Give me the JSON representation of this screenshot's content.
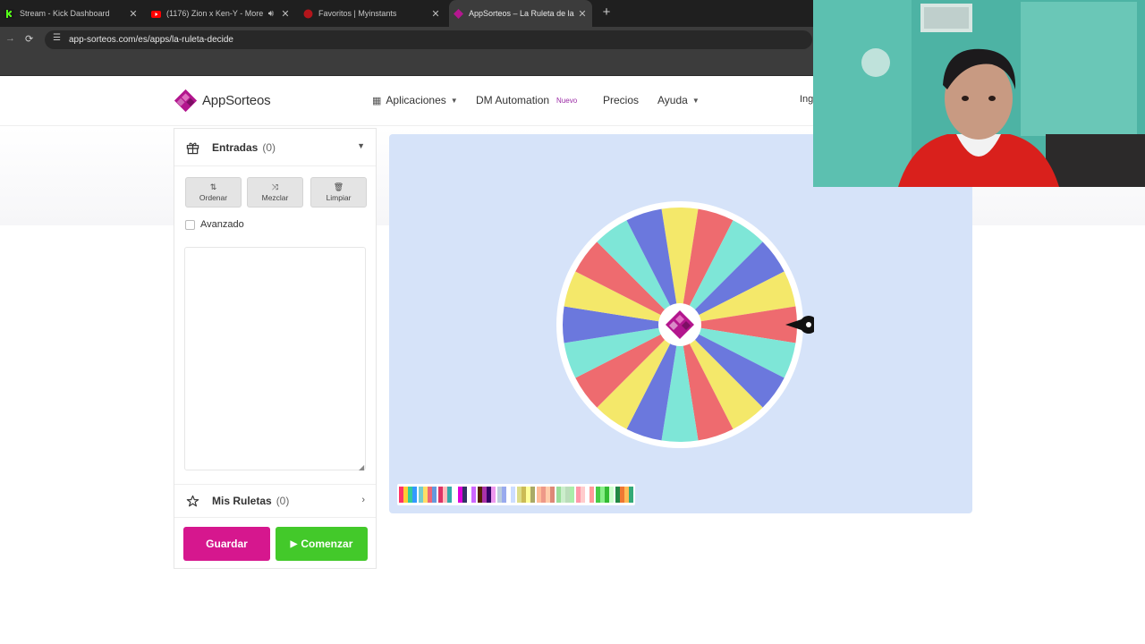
{
  "browser": {
    "tabs": [
      {
        "title": "Stream - Kick Dashboard",
        "favicon": "kick-icon",
        "active": false
      },
      {
        "title": "(1176) Zion x Ken-Y - More",
        "favicon": "youtube-icon",
        "active": false,
        "audio": true
      },
      {
        "title": "Favoritos | Myinstants",
        "favicon": "myinstants-icon",
        "active": false
      },
      {
        "title": "AppSorteos – La Ruleta de la Su",
        "favicon": "appsorteos-icon",
        "active": true
      }
    ],
    "url": "app-sorteos.com/es/apps/la-ruleta-decide"
  },
  "header": {
    "logo_text": "AppSorteos",
    "nav": {
      "aplicaciones": "Aplicaciones",
      "dm_automation": "DM Automation",
      "nuevo_badge": "Nuevo",
      "precios": "Precios",
      "ayuda": "Ayuda",
      "login_peek": "Ing"
    }
  },
  "left_panel": {
    "entradas": {
      "title": "Entradas",
      "count": "(0)"
    },
    "tools": {
      "ordenar": "Ordenar",
      "mezclar": "Mezclar",
      "limpiar": "Limpiar"
    },
    "avanzado_label": "Avanzado",
    "avanzado_checked": false,
    "entries_text": "",
    "mis_ruletas": {
      "title": "Mis Ruletas",
      "count": "(0)"
    },
    "guardar_label": "Guardar",
    "comenzar_label": "Comenzar"
  },
  "wheel": {
    "segment_count": 20,
    "colors": [
      "#f4e86a",
      "#ee6b6f",
      "#7ee6d7",
      "#6b78dd"
    ],
    "center_icon": "appsorteos-logo-icon",
    "pointer_icon": "pointer-icon"
  },
  "palettes": [
    [
      "#f36",
      "#fc3",
      "#3c9",
      "#39f"
    ],
    [
      "#7cc",
      "#fd6",
      "#e67",
      "#69d"
    ],
    [
      "#d36",
      "#fbb",
      "#3aa",
      "#fff"
    ],
    [
      "#d0d",
      "#336",
      "#fff",
      "#c6f"
    ],
    [
      "#520",
      "#a3a",
      "#306",
      "#e9e"
    ],
    [
      "#bcd",
      "#9ae",
      "#fff",
      "#cdf"
    ],
    [
      "#dd8",
      "#cb5",
      "#ff9",
      "#aa6"
    ],
    [
      "#fb9",
      "#e98",
      "#fca",
      "#d87"
    ],
    [
      "#9d9",
      "#cec",
      "#bdb",
      "#aea"
    ],
    [
      "#f9a",
      "#fcc",
      "#fff",
      "#f99"
    ],
    [
      "#4c4",
      "#8e8",
      "#3b3",
      "#cfc"
    ],
    [
      "#284",
      "#e73",
      "#fb5",
      "#3a7"
    ]
  ]
}
